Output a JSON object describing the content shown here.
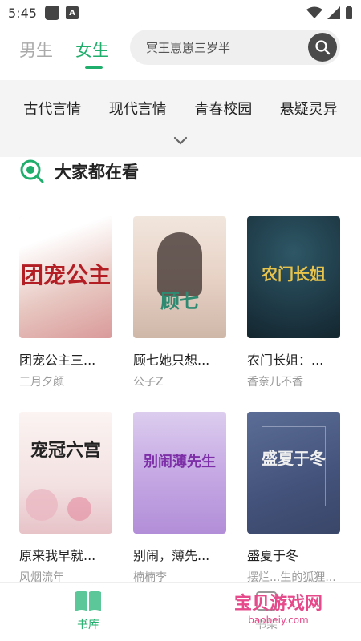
{
  "status": {
    "time": "5:45"
  },
  "tabs": [
    {
      "label": "男生"
    },
    {
      "label": "女生"
    }
  ],
  "search": {
    "query": "冥王崽崽三岁半"
  },
  "categories": [
    "古代言情",
    "现代言情",
    "青春校园",
    "悬疑灵异"
  ],
  "section": {
    "title": "大家都在看"
  },
  "books": [
    {
      "title": "团宠公主三...",
      "author": "三月夕颜",
      "cover_text": "团宠公主",
      "cover_color": "#f3e8e4",
      "text_color": "#b31d24"
    },
    {
      "title": "顾七她只想...",
      "author": "公子Z",
      "cover_text": "顾七",
      "cover_color": "#e9dcd3",
      "text_color": "#2f8a72"
    },
    {
      "title": "农门长姐：...",
      "author": "香奈儿不香",
      "cover_text": "农门长姐",
      "cover_color": "#1d3b48",
      "text_color": "#e8c44c"
    },
    {
      "title": "原来我早就...",
      "author": "风烟流年",
      "cover_text": "宠冠六宫",
      "cover_color": "#f6ecec",
      "text_color": "#222"
    },
    {
      "title": "别闹，薄先...",
      "author": "楠楠李",
      "cover_text": "别闹薄先生",
      "cover_color": "#c9b2e3",
      "text_color": "#7d2fa8"
    },
    {
      "title": "盛夏于冬",
      "author": "摆烂...生的狐狸...",
      "cover_text": "盛夏于冬",
      "cover_color": "#4b5c86",
      "text_color": "#f0f0f0"
    }
  ],
  "nav": {
    "library": "书库",
    "shelf": "书架"
  },
  "watermark": {
    "main": "宝贝游戏网",
    "sub": "baobeiy.com"
  },
  "colors": {
    "accent": "#1fae6b"
  }
}
